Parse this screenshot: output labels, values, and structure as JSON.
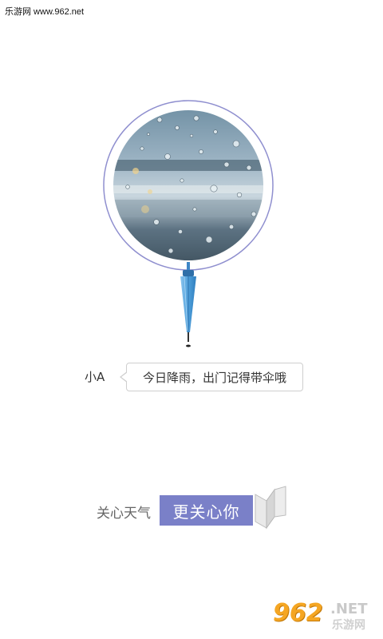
{
  "watermark_top": "乐游网 www.962.net",
  "illustration": {
    "photo_icon": "rain-on-window-photo",
    "umbrella_icon": "closed-umbrella-icon",
    "accent_color": "#7a80c8",
    "umbrella_color": "#5aa9e0"
  },
  "dialog": {
    "speaker": "小A",
    "message": "今日降雨，出门记得带伞哦"
  },
  "slogan": {
    "plain": "关心天气",
    "highlight": "更关心你",
    "book_icon": "open-book-icon"
  },
  "watermark_bottom": {
    "number": "962",
    "suffix": ".NET",
    "chinese": "乐游网"
  }
}
